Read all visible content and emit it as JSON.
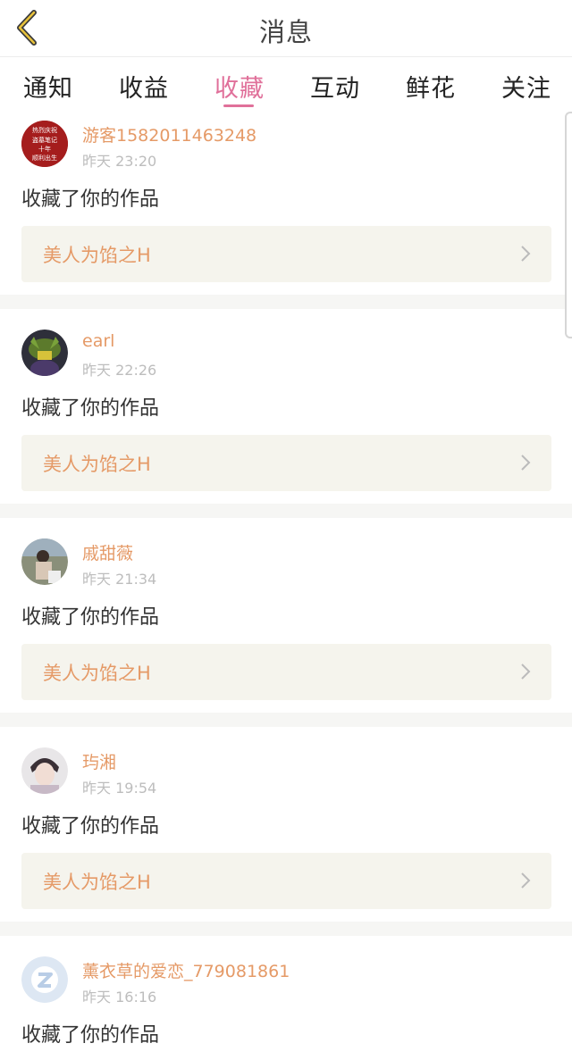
{
  "header": {
    "title": "消息"
  },
  "tabs": [
    {
      "label": "通知"
    },
    {
      "label": "收益"
    },
    {
      "label": "收藏"
    },
    {
      "label": "互动"
    },
    {
      "label": "鲜花"
    },
    {
      "label": "关注"
    }
  ],
  "active_tab": "收藏",
  "messages": [
    {
      "user": "游客1582011463248",
      "time": "昨天 23:20",
      "action": "收藏了你的作品",
      "work": "美人为馅之H",
      "avatar_text": [
        "热烈庆祝",
        "盗墓笔记",
        "十年",
        "顺利出生"
      ]
    },
    {
      "user": "earl",
      "time": "昨天 22:26",
      "action": "收藏了你的作品",
      "work": "美人为馅之H"
    },
    {
      "user": "戚甜薇",
      "time": "昨天 21:34",
      "action": "收藏了你的作品",
      "work": "美人为馅之H"
    },
    {
      "user": "玙湘",
      "time": "昨天 19:54",
      "action": "收藏了你的作品",
      "work": "美人为馅之H"
    },
    {
      "user": "薰衣草的爱恋_779081861",
      "time": "昨天 16:16",
      "action": "收藏了你的作品",
      "work": ""
    }
  ],
  "colors": {
    "accent": "#e0709a",
    "username": "#e59a67",
    "card_bg": "#f5f4ed"
  }
}
